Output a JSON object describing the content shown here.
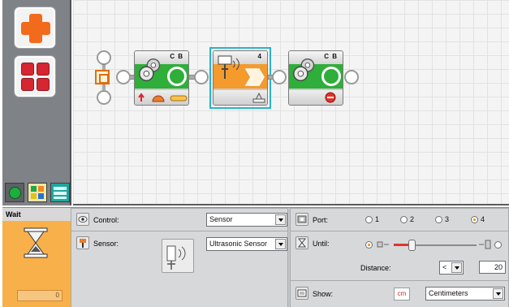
{
  "program": {
    "blocks": [
      {
        "kind": "move",
        "ports": "C B"
      },
      {
        "kind": "wait-ultrasonic",
        "ports": "4"
      },
      {
        "kind": "move",
        "ports": "C B"
      }
    ]
  },
  "config": {
    "title": "Wait",
    "counter": "0",
    "control_label": "Control:",
    "control_value": "Sensor",
    "sensor_label": "Sensor:",
    "sensor_value": "Ultrasonic Sensor",
    "port_label": "Port:",
    "ports": [
      "1",
      "2",
      "3",
      "4"
    ],
    "port_selected": "4",
    "until_label": "Until:",
    "distance_level": 0.22,
    "distance_label": "Distance:",
    "comparison_value": "<",
    "distance_value": "20",
    "show_label": "Show:",
    "unit_badge": "cm",
    "unit_value": "Centimeters"
  },
  "colors": {
    "accent": "#f26a1c",
    "block_green": "#2fae3a",
    "block_orange": "#f59a2c",
    "selection": "#2db2c8"
  }
}
